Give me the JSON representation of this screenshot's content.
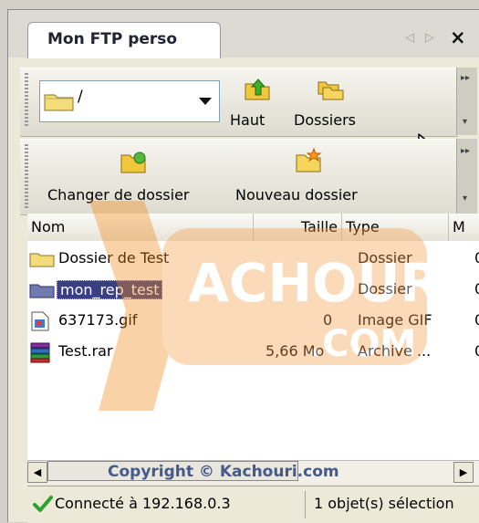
{
  "tab": {
    "title": "Mon FTP perso",
    "scroll_left": "◁",
    "scroll_right": "▷",
    "close": "×"
  },
  "toolbar1": {
    "path_value": "/",
    "up_label": "Haut",
    "folders_label": "Dossiers"
  },
  "toolbar2": {
    "change_folder_label": "Changer de dossier",
    "new_folder_label": "Nouveau dossier"
  },
  "columns": [
    "Nom",
    "Taille",
    "Type",
    "M"
  ],
  "rows": [
    {
      "name": "Dossier de Test",
      "size": "",
      "type": "Dossier",
      "modified": "0",
      "icon": "folder-icon"
    },
    {
      "name": "mon_rep_test",
      "size": "",
      "type": "Dossier",
      "modified": "0",
      "icon": "folder-icon",
      "selected": true
    },
    {
      "name": "637173.gif",
      "size": "0",
      "type": "Image GIF",
      "modified": "0",
      "icon": "image-file-icon"
    },
    {
      "name": "Test.rar",
      "size": "5,66 Mo",
      "type": "Archive ...",
      "modified": "0",
      "icon": "archive-icon"
    }
  ],
  "watermark": {
    "text1": "ACHOURI",
    "text2": ".COM"
  },
  "scrollbar": {
    "left_arrow": "◀",
    "right_arrow": "▶"
  },
  "copyright": "Copyright © Kachouri.com",
  "status": {
    "connection": "Connecté à 192.168.0.3",
    "selection": "1 objet(s) sélection"
  },
  "colors": {
    "selection_bg": "#3a3e85",
    "folder_yellow": "#f3dc7a",
    "watermark_orange": "#f28a1c",
    "status_green": "#2aa12a"
  }
}
